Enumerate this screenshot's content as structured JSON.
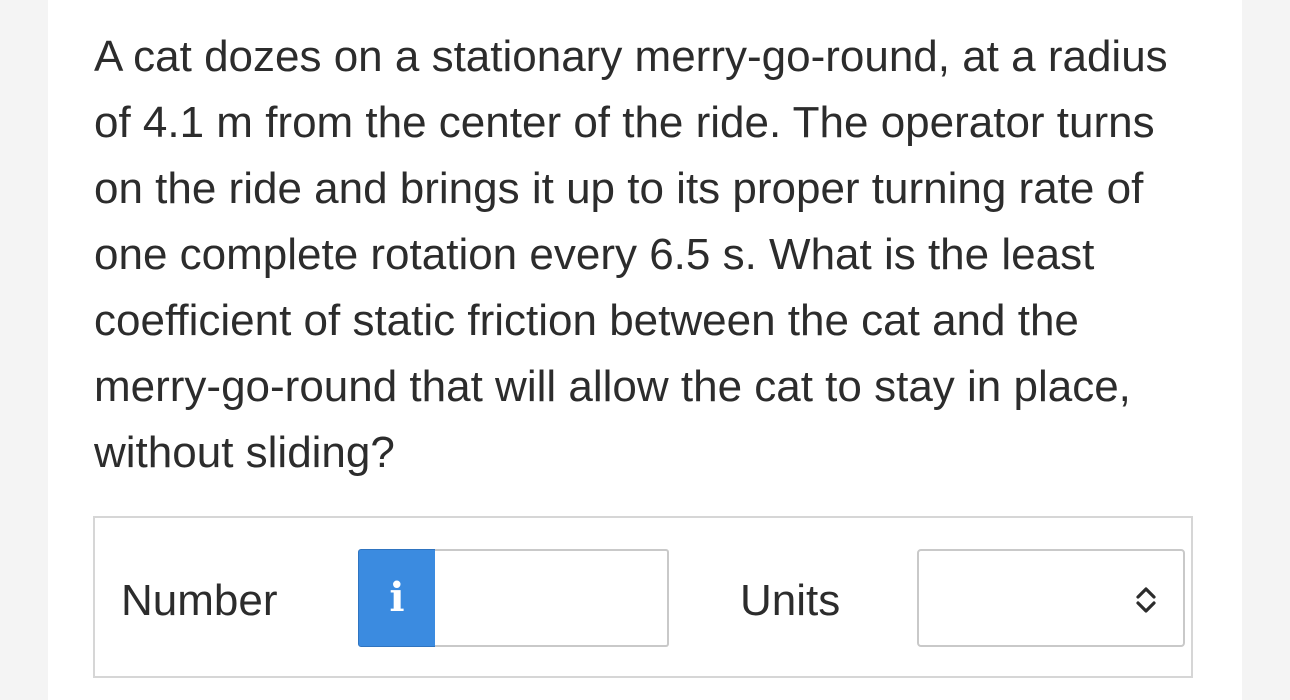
{
  "question": {
    "text": "A cat dozes on a stationary merry-go-round, at a radius of 4.1 m from the center of the ride. The operator turns on the ride and brings it up to its proper turning rate of one complete rotation every 6.5 s. What is the least coefficient of static friction between the cat and the merry-go-round that will allow the cat to stay in place, without sliding?"
  },
  "answer": {
    "number_label": "Number",
    "info_icon": "info-icon",
    "info_glyph": "i",
    "number_value": "",
    "units_label": "Units",
    "units_value": "",
    "units_icon": "chevron-up-down-icon"
  },
  "colors": {
    "accent": "#3b8be0",
    "border": "#c9c9c9",
    "text": "#2c2c2c"
  }
}
